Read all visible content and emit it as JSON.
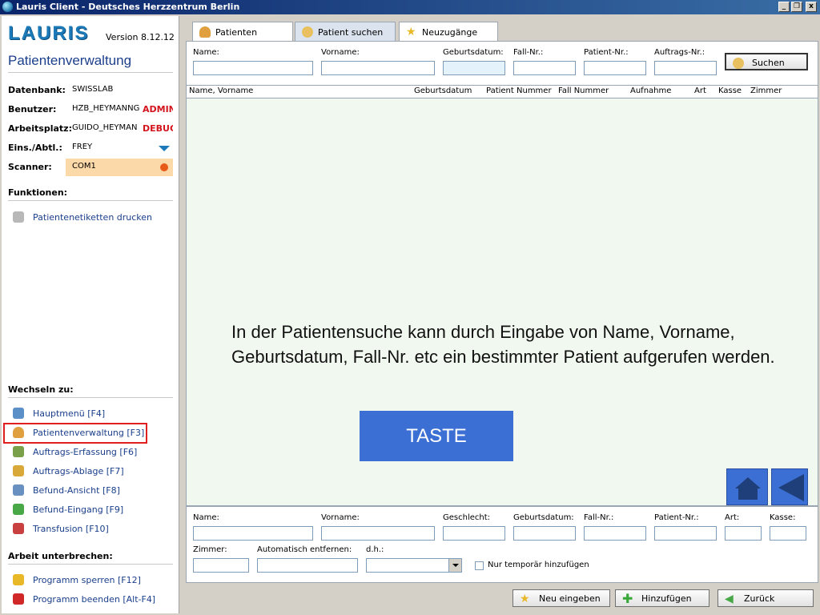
{
  "window": {
    "title": "Lauris Client - Deutsches Herzzentrum Berlin",
    "controls": [
      "_",
      "❐",
      "x"
    ]
  },
  "sidebar": {
    "brand": "LAURIS",
    "version": "Version 8.12.12",
    "module_title": "Patientenverwaltung",
    "info": [
      {
        "label": "Datenbank:",
        "value": "SWISSLAB",
        "tag": ""
      },
      {
        "label": "Benutzer:",
        "value": "HZB_HEYMANNG",
        "tag": "ADMIN"
      },
      {
        "label": "Arbeitsplatz:",
        "value": "GUIDO_HEYMAN",
        "tag": "DEBUG"
      },
      {
        "label": "Eins./Abtl.:",
        "value": "FREY",
        "tag": ""
      },
      {
        "label": "Scanner:",
        "value": "COM1",
        "tag": ""
      }
    ],
    "functions_header": "Funktionen:",
    "functions": [
      {
        "label": "Patientenetiketten drucken",
        "icon": "printer-icon"
      }
    ],
    "switch_header": "Wechseln zu:",
    "switch_items": [
      {
        "label": "Hauptmenü [F4]",
        "icon": "home-icon",
        "color": "#5a8fc8"
      },
      {
        "label": "Patientenverwaltung [F3]",
        "icon": "user-icon",
        "color": "#e0a040"
      },
      {
        "label": "Auftrags-Erfassung [F6]",
        "icon": "pencil-icon",
        "color": "#7aa04a"
      },
      {
        "label": "Auftrags-Ablage [F7]",
        "icon": "folder-icon",
        "color": "#d8a838"
      },
      {
        "label": "Befund-Ansicht [F8]",
        "icon": "magnifier-icon",
        "color": "#6890c0"
      },
      {
        "label": "Befund-Eingang [F9]",
        "icon": "download-icon",
        "color": "#48a848"
      },
      {
        "label": "Transfusion [F10]",
        "icon": "blood-bag-icon",
        "color": "#c84040"
      }
    ],
    "break_header": "Arbeit unterbrechen:",
    "break_items": [
      {
        "label": "Programm sperren [F12]",
        "icon": "lock-icon",
        "color": "#e8b828"
      },
      {
        "label": "Programm beenden [Alt-F4]",
        "icon": "power-icon",
        "color": "#d02828"
      }
    ]
  },
  "tabs": [
    {
      "label": "Patienten",
      "icon": "user-icon"
    },
    {
      "label": "Patient suchen",
      "icon": "magnifier-icon"
    },
    {
      "label": "Neuzugänge",
      "icon": "star-icon"
    }
  ],
  "search": {
    "name_label": "Name:",
    "vorname_label": "Vorname:",
    "geburtsdatum_label": "Geburtsdatum:",
    "fall_label": "Fall-Nr.:",
    "patient_label": "Patient-Nr.:",
    "auftrag_label": "Auftrags-Nr.:",
    "button": "Suchen"
  },
  "grid_columns": [
    "Name,  Vorname",
    "Geburtsdatum",
    "Patient Nummer",
    "Fall Nummer",
    "Aufnahme",
    "Art",
    "Kasse",
    "Zimmer"
  ],
  "overlay": {
    "text": "In der Patientensuche kann durch Eingabe von Name, Vorname, Geburtsdatum, Fall-Nr. etc ein bestimmter Patient aufgerufen werden.",
    "button": "TASTE"
  },
  "form": {
    "name": "Name:",
    "vorname": "Vorname:",
    "geschlecht": "Geschlecht:",
    "geburtsdatum": "Geburtsdatum:",
    "fall": "Fall-Nr.:",
    "patient": "Patient-Nr.:",
    "art": "Art:",
    "kasse": "Kasse:",
    "zimmer": "Zimmer:",
    "auto_remove": "Automatisch entfernen:",
    "dh": "d.h.:",
    "temp_checkbox": "Nur temporär hinzufügen"
  },
  "footer": {
    "new_button": "Neu eingeben",
    "add_button": "Hinzufügen",
    "back_button": "Zurück"
  }
}
